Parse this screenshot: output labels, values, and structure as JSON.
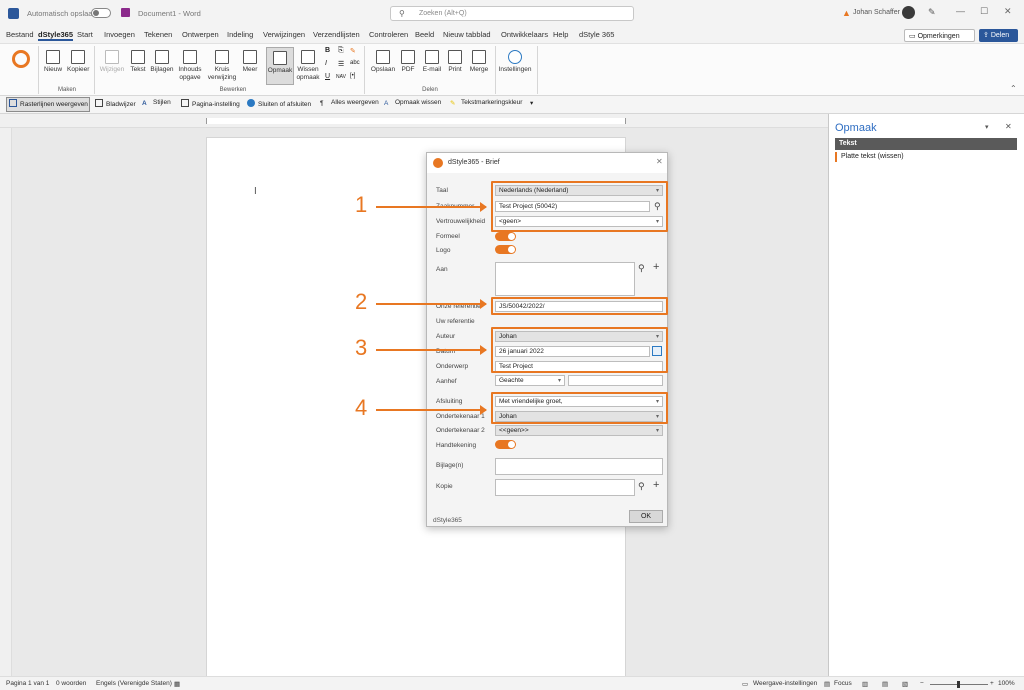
{
  "titlebar": {
    "autosave_label": "Automatisch opslaan",
    "doc_title": "Document1 - Word",
    "search_placeholder": "Zoeken (Alt+Q)",
    "user_name": "Johan Schaffer"
  },
  "tabs": [
    "Bestand",
    "dStyle365",
    "Start",
    "Invoegen",
    "Tekenen",
    "Ontwerpen",
    "Indeling",
    "Verwijzingen",
    "Verzendlijsten",
    "Controleren",
    "Beeld",
    "Nieuw tabblad",
    "Ontwikkelaars",
    "Help",
    "dStyle 365"
  ],
  "tabs_right": {
    "comments": "Opmerkingen",
    "share": "Delen"
  },
  "ribbon": {
    "maken": {
      "nieuw": "Nieuw",
      "kopieer": "Kopieer",
      "label": "Maken"
    },
    "bewerken": {
      "wijzigen": "Wijzigen",
      "tekst": "Tekst",
      "bijlagen": "Bijlagen",
      "inhoudsopgave_1": "Inhouds",
      "inhoudsopgave_2": "opgave",
      "kruis_1": "Kruis",
      "kruis_2": "verwijzing",
      "meer": "Meer",
      "opmaak": "Opmaak",
      "wissen_1": "Wissen",
      "wissen_2": "opmaak",
      "label": "Bewerken",
      "fmt_b": "B",
      "fmt_i": "I",
      "fmt_u": "U",
      "fmt_nav": "NAV",
      "fmt_brackets": "[•]",
      "fmt_abc": "abc"
    },
    "delen": {
      "opslaan": "Opslaan",
      "pdf": "PDF",
      "email": "E-mail",
      "print": "Print",
      "merge": "Merge",
      "label": "Delen"
    },
    "instellingen": "Instellingen"
  },
  "toolbar": [
    "Rasterlijnen weergeven",
    "Bladwijzer",
    "Stijlen",
    "Pagina-instelling",
    "Sluiten of afsluiten",
    "Alles weergeven",
    "Opmaak wissen",
    "Tekstmarkeringskleur"
  ],
  "pane": {
    "title": "Opmaak",
    "header": "Tekst",
    "item": "Platte tekst (wissen)"
  },
  "dialog": {
    "title": "dStyle365 - Brief",
    "taal_label": "Taal",
    "taal_value": "Nederlands (Nederland)",
    "zaak_label": "Zaaknummer",
    "zaak_value": "Test Project (50042)",
    "vertrouw_label": "Vertrouwelijkheid",
    "vertrouw_value": "<geen>",
    "formeel_label": "Formeel",
    "logo_label": "Logo",
    "aan_label": "Aan",
    "onze_label": "Onze referentie",
    "onze_value": "JS/50042/2022/",
    "uw_label": "Uw referentie",
    "auteur_label": "Auteur",
    "auteur_value": "Johan",
    "datum_label": "Datum",
    "datum_value": "26 januari 2022",
    "onderwerp_label": "Onderwerp",
    "onderwerp_value": "Test Project",
    "aanhef_label": "Aanhef",
    "aanhef_value": "Geachte",
    "afsluiting_label": "Afsluiting",
    "afsluiting_value": "Met vriendelijke groet,",
    "ond1_label": "Ondertekenaar 1",
    "ond1_value": "Johan",
    "ond2_label": "Ondertekenaar 2",
    "ond2_value": "<<geen>>",
    "handtek_label": "Handtekening",
    "bijlage_label": "Bijlage(n)",
    "kopie_label": "Kopie",
    "footer_brand": "dStyle365",
    "ok": "OK"
  },
  "annotations": [
    "1",
    "2",
    "3",
    "4"
  ],
  "status": {
    "page": "Pagina 1 van 1",
    "words": "0 woorden",
    "lang": "Engels (Verenigde Staten)",
    "view_settings": "Weergave-instellingen",
    "focus": "Focus",
    "zoom": "100%"
  },
  "colors": {
    "accent": "#e87722",
    "word_blue": "#2b579a"
  }
}
